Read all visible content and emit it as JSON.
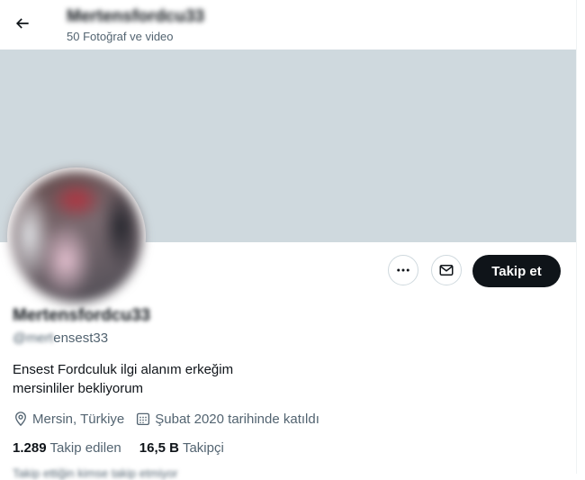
{
  "header": {
    "title": "Mertensfordcu33",
    "subtitle": "50 Fotoğraf ve video"
  },
  "actions": {
    "follow_label": "Takip et"
  },
  "profile": {
    "display_name": "Mertensfordcu33",
    "handle_blurred": "@mert",
    "handle_visible": "ensest33",
    "bio_line1": "Ensest Fordculuk ilgi alanım erkeğim",
    "bio_line2": "mersinliler bekliyorum",
    "location": "Mersin, Türkiye",
    "joined": "Şubat 2020 tarihinde katıldı"
  },
  "stats": {
    "following_count": "1.289",
    "following_label": "Takip edilen",
    "followers_count": "16,5 B",
    "followers_label": "Takipçi"
  },
  "followed_by_hint": "Takip ettiğin kimse takip etmiyor",
  "colors": {
    "banner": "#cfd9de",
    "text_primary": "#0f1419",
    "text_secondary": "#536471",
    "follow_button": "#0f1419"
  },
  "icons": [
    "back-arrow-icon",
    "more-icon",
    "mail-icon",
    "location-icon",
    "calendar-icon"
  ]
}
